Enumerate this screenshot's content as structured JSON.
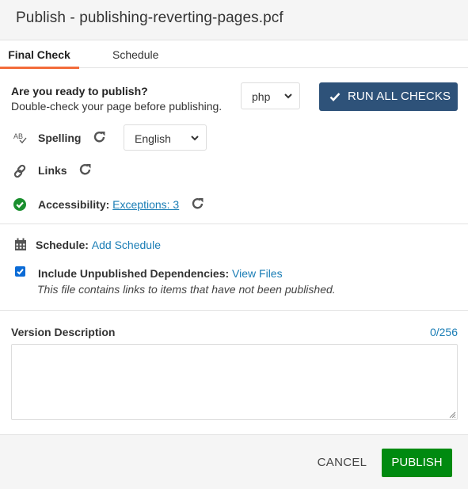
{
  "dialog": {
    "title": "Publish - publishing-reverting-pages.pcf"
  },
  "tabs": [
    {
      "label": "Final Check",
      "active": true
    },
    {
      "label": "Schedule",
      "active": false
    }
  ],
  "final_check": {
    "ready_title": "Are you ready to publish?",
    "ready_subtitle": "Double-check your page before publishing.",
    "format_select": {
      "value": "php"
    },
    "run_all_label": "RUN ALL CHECKS",
    "checks": {
      "spelling": {
        "label": "Spelling",
        "icon": "spellcheck-icon",
        "language": "English"
      },
      "links": {
        "label": "Links",
        "icon": "link-icon"
      },
      "accessibility": {
        "label": "Accessibility:",
        "icon": "check-circle-icon",
        "status_color": "#1a8f2e",
        "exceptions_link": "Exceptions: 3"
      }
    }
  },
  "schedule": {
    "label": "Schedule:",
    "icon": "calendar-icon",
    "link": "Add Schedule"
  },
  "dependencies": {
    "checked": true,
    "label": "Include Unpublished Dependencies:",
    "link": "View Files",
    "note": "This file contains links to items that have not been published."
  },
  "version_description": {
    "label": "Version Description",
    "count": "0/256",
    "value": "",
    "placeholder": ""
  },
  "footer": {
    "cancel_label": "CANCEL",
    "publish_label": "PUBLISH"
  },
  "colors": {
    "accent_tab": "#f26b3a",
    "primary_button": "#2e5279",
    "publish_button": "#008a10",
    "link": "#1a7db5"
  }
}
